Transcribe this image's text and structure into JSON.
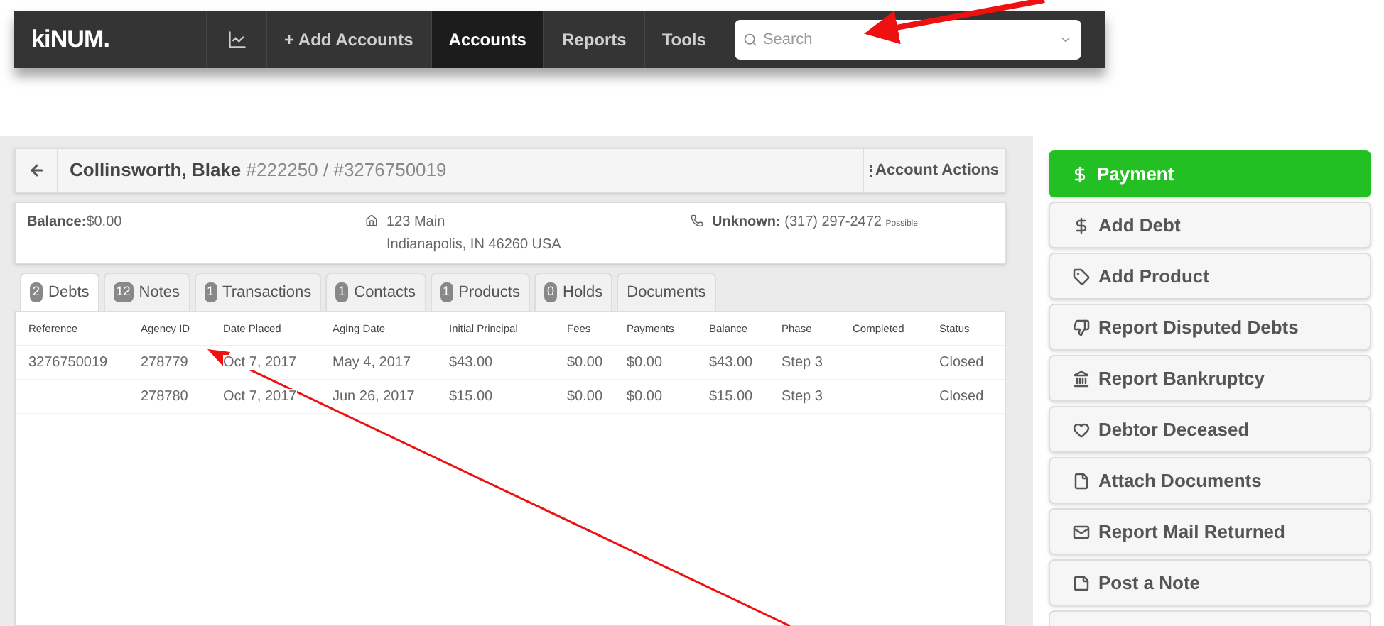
{
  "navbar": {
    "logo": "kiNUM.",
    "items": [
      {
        "label": "+ Add Accounts",
        "selected": false
      },
      {
        "label": "Accounts",
        "selected": true
      },
      {
        "label": "Reports",
        "selected": false
      },
      {
        "label": "Tools",
        "selected": false
      }
    ],
    "search": {
      "placeholder": "Search"
    }
  },
  "account": {
    "name": "Collinsworth, Blake",
    "ids": "#222250 / #3276750019",
    "actions": "Account Actions",
    "balance_label": "Balance:",
    "balance": "$0.00",
    "address": [
      "123 Main",
      "Indianapolis, IN 46260 USA"
    ],
    "phone_label": "Unknown:",
    "phone": "(317) 297-2472",
    "phone_note": "Possible"
  },
  "tabs": [
    {
      "count": "2",
      "label": "Debts",
      "selected": true
    },
    {
      "count": "12",
      "label": "Notes",
      "selected": false
    },
    {
      "count": "1",
      "label": "Transactions",
      "selected": false
    },
    {
      "count": "1",
      "label": "Contacts",
      "selected": false
    },
    {
      "count": "1",
      "label": "Products",
      "selected": false
    },
    {
      "count": "0",
      "label": "Holds",
      "selected": false
    },
    {
      "label": "Documents",
      "selected": false
    }
  ],
  "table": {
    "columns": [
      "Reference",
      "Agency ID",
      "Date Placed",
      "Aging Date",
      "Initial Principal",
      "Fees",
      "Payments",
      "Balance",
      "Phase",
      "Completed",
      "Status"
    ],
    "rows": [
      [
        "3276750019",
        "278779",
        "Oct 7, 2017",
        "May 4, 2017",
        "$43.00",
        "$0.00",
        "$0.00",
        "$43.00",
        "Step 3",
        "",
        "Closed"
      ],
      [
        "",
        "278780",
        "Oct 7, 2017",
        "Jun 26, 2017",
        "$15.00",
        "$0.00",
        "$0.00",
        "$15.00",
        "Step 3",
        "",
        "Closed"
      ]
    ]
  },
  "actions": [
    {
      "label": "Payment",
      "kind": "primary"
    },
    {
      "label": "Add Debt",
      "kind": "default"
    },
    {
      "label": "Add Product",
      "kind": "default"
    },
    {
      "label": "Report Disputed Debts",
      "kind": "default"
    },
    {
      "label": "Report Bankruptcy",
      "kind": "default"
    },
    {
      "label": "Debtor Deceased",
      "kind": "default"
    },
    {
      "label": "Attach Documents",
      "kind": "default"
    },
    {
      "label": "Report Mail Returned",
      "kind": "default"
    },
    {
      "label": "Post a Note",
      "kind": "default"
    }
  ]
}
